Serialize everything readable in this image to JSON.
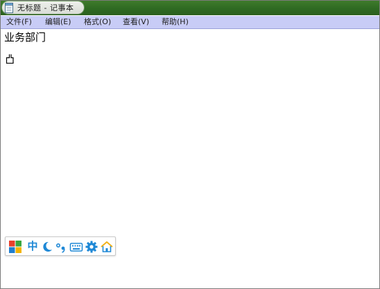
{
  "window": {
    "title": "无标题 - 记事本"
  },
  "menu": {
    "items": [
      {
        "label": "文件(F)"
      },
      {
        "label": "编辑(E)"
      },
      {
        "label": "格式(O)"
      },
      {
        "label": "查看(V)"
      },
      {
        "label": "帮助(H)"
      }
    ]
  },
  "document": {
    "lines": [
      "业务部门"
    ]
  },
  "ime_toolbar": {
    "mode_label": "中",
    "icons": [
      "windows-logo-icon",
      "chinese-mode-icon",
      "half-width-moon-icon",
      "punctuation-icon",
      "soft-keyboard-icon",
      "settings-gear-icon",
      "home-icon"
    ],
    "colors": {
      "logo_red": "#e8412c",
      "logo_green": "#3aa640",
      "logo_blue": "#1f7fd0",
      "logo_yellow": "#f4b400",
      "accent_blue": "#1e88d6",
      "home_yellow": "#f2b21a"
    }
  },
  "colors": {
    "titlebar": "#2f6a22",
    "menubar": "#c8ccf6",
    "editor_bg": "#ffffff"
  }
}
